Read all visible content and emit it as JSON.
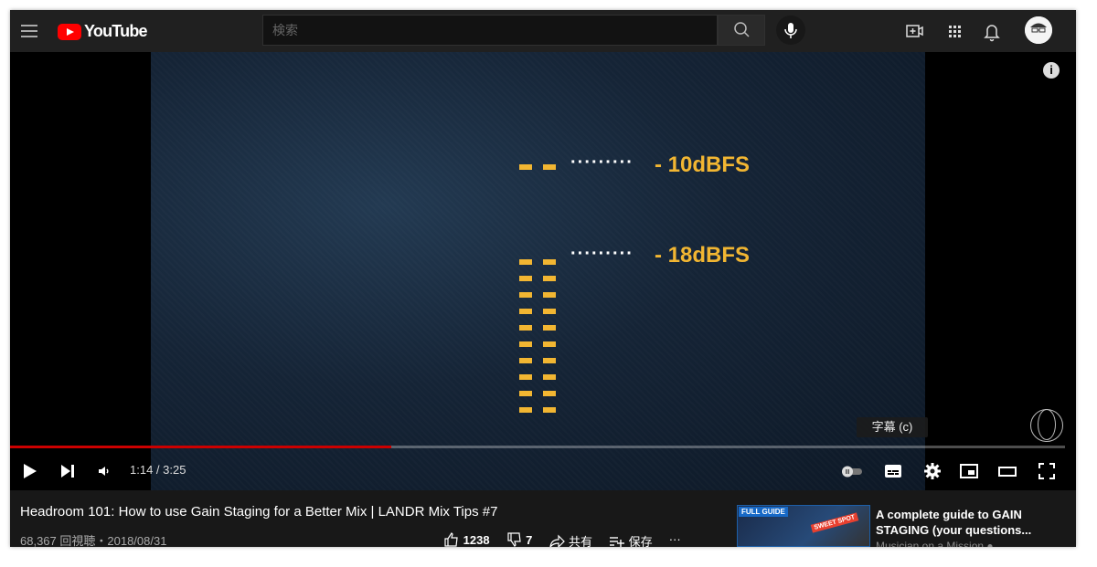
{
  "header": {
    "logo_text": "YouTube",
    "search_placeholder": "検索"
  },
  "video": {
    "label_top": "- 10dBFS",
    "label_bottom": "- 18dBFS",
    "dots": "·········",
    "info_glyph": "i",
    "tooltip": "字幕 (c)"
  },
  "player": {
    "current_time": "1:14",
    "duration": "3:25",
    "time_display": "1:14 / 3:25",
    "progress_fraction": 0.361
  },
  "details": {
    "title": "Headroom 101: How to use Gain Staging for a Better Mix | LANDR Mix Tips #7",
    "meta": "68,367 回視聴・2018/08/31",
    "likes": "1238",
    "dislikes": "7",
    "share_label": "共有",
    "save_label": "保存",
    "more_label": "···"
  },
  "recommendation": {
    "thumb_badge": "FULL GUIDE",
    "thumb_sticker": "SWEET SPOT",
    "title": "A complete guide to GAIN STAGING (your questions...",
    "channel": "Musician on a Mission ●"
  },
  "icons": {
    "menu": "menu-icon",
    "search": "search-icon",
    "mic": "mic-icon",
    "create": "video-create-icon",
    "apps": "apps-icon",
    "notifications": "bell-icon"
  },
  "colors": {
    "accent": "#ff0000",
    "meter": "#f2b632",
    "progress": "#cc0000"
  }
}
